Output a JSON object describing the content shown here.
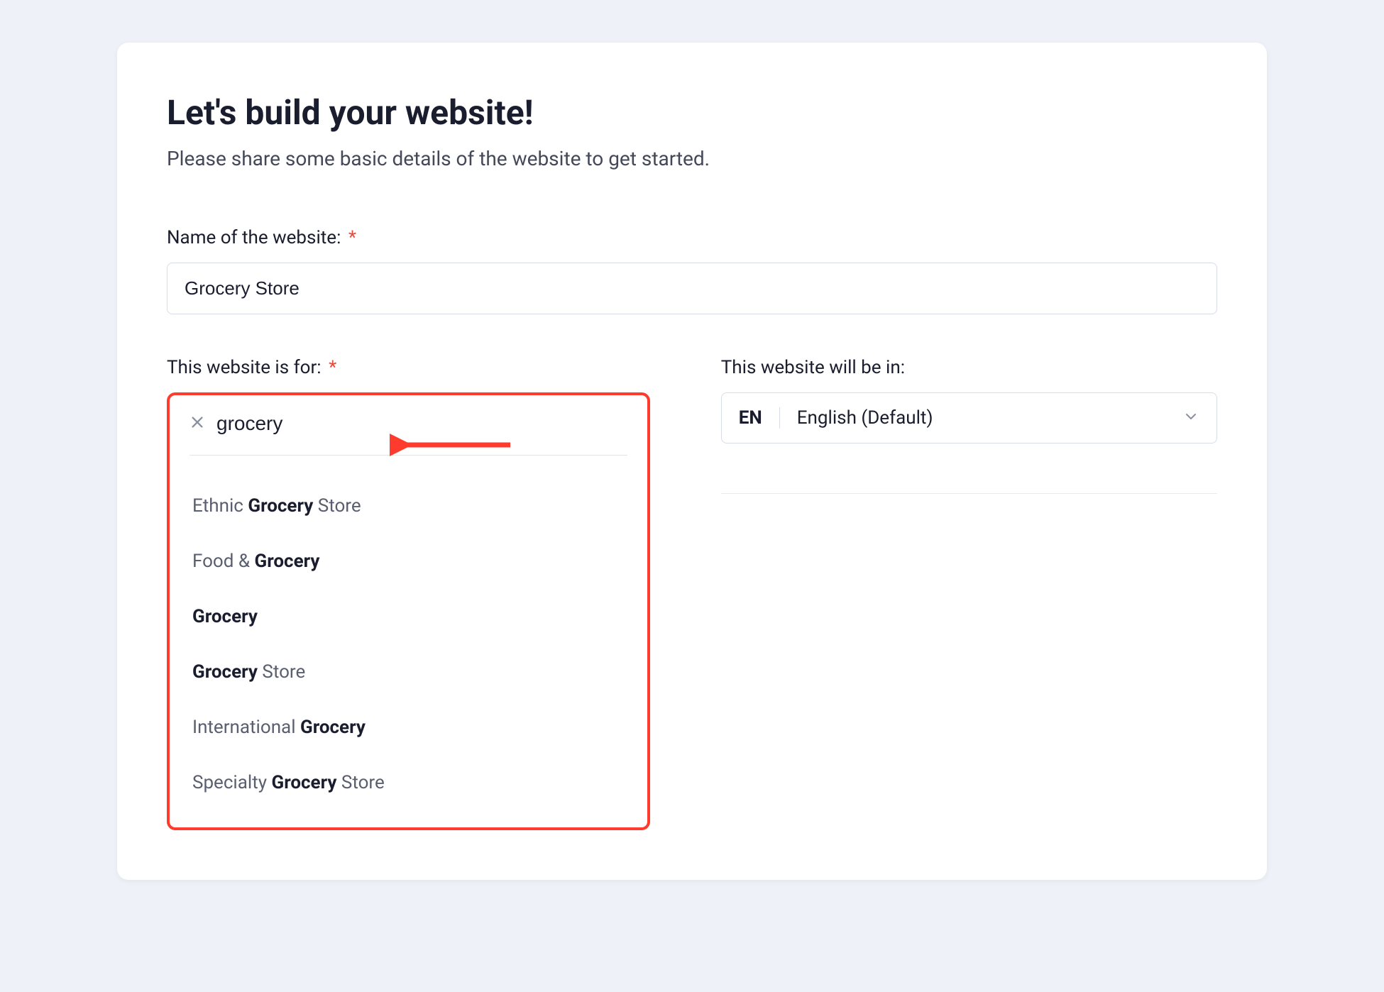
{
  "header": {
    "title": "Let's build your website!",
    "subtitle": "Please share some basic details of the website to get started."
  },
  "form": {
    "name_field": {
      "label": "Name of the website:",
      "required_mark": "*",
      "value": "Grocery Store"
    },
    "type_field": {
      "label": "This website is for:",
      "required_mark": "*",
      "search_value": "grocery",
      "options": [
        {
          "prefix": "Ethnic ",
          "match": "Grocery",
          "suffix": " Store"
        },
        {
          "prefix": "Food & ",
          "match": "Grocery",
          "suffix": ""
        },
        {
          "prefix": "",
          "match": "Grocery",
          "suffix": ""
        },
        {
          "prefix": "",
          "match": "Grocery",
          "suffix": " Store"
        },
        {
          "prefix": "International ",
          "match": "Grocery",
          "suffix": ""
        },
        {
          "prefix": "Specialty ",
          "match": "Grocery",
          "suffix": " Store"
        }
      ]
    },
    "language_field": {
      "label": "This website will be in:",
      "code": "EN",
      "name": "English (Default)"
    }
  }
}
